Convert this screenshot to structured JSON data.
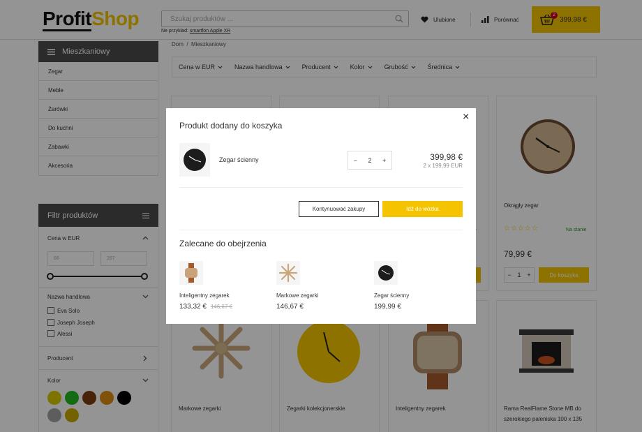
{
  "header": {
    "logo_part1": "Profit",
    "logo_part2": "Shop",
    "search_placeholder": "Szukaj produktów ...",
    "search_hint_prefix": "Ne przykład:",
    "search_hint_link": "smartfon Apple XR",
    "favorites_label": "Ulubione",
    "compare_label": "Porównać",
    "cart_count": "2",
    "cart_total": "399,98 €"
  },
  "sidebar": {
    "category_title": "Mieszkaniowy",
    "categories": [
      "Zegar",
      "Meble",
      "Żarówki",
      "Do kuchni",
      "Zabawki",
      "Akcesoria"
    ],
    "filter_title": "Filtr produktów",
    "price_label": "Cena w EUR",
    "price_min": "66",
    "price_max": "267",
    "brand_label": "Nazwa handlowa",
    "brands": [
      "Eva Solo",
      "Joseph Joseph",
      "Alessi"
    ],
    "producer_label": "Producent",
    "color_label": "Kolor",
    "colors": [
      "#d8c800",
      "#22bb22",
      "#7a3e10",
      "#dd8c10",
      "#000000",
      "#a0a0a0",
      "#c8a800"
    ]
  },
  "main": {
    "breadcrumb_home": "Dom",
    "breadcrumb_sep": "/",
    "breadcrumb_current": "Mieszkaniowy",
    "filter_dropdowns": [
      "Cena w EUR",
      "Nazwa handlowa",
      "Producent",
      "Kolor",
      "Grubość",
      "Średnica"
    ],
    "top_right_product": {
      "name": "Okrągły zegar",
      "stock": "Na stanie",
      "price": "79,99 €",
      "qty": "1",
      "add_label": "Do koszyka"
    },
    "bottom_products": [
      "Markowe zegarki",
      "Zegarki kolekcjonerskie",
      "Inteligentny zegarek",
      "Rama RealFlame Stone MB do szerokiego paleniska 100 x 135"
    ]
  },
  "modal": {
    "title": "Produkt dodany do koszyka",
    "close_symbol": "×",
    "item_name": "Zegar ścienny",
    "qty": "2",
    "minus": "−",
    "plus": "+",
    "total": "399,98 €",
    "unit_line": "2 x 199,99 EUR",
    "continue_label": "Kontynuować zakupy",
    "cart_label": "Idź do wózka",
    "rec_title": "Zalecane do obejrzenia",
    "recommendations": [
      {
        "name": "Inteligentny zegarek",
        "price": "133,32 €",
        "old_price": "146,67 €"
      },
      {
        "name": "Markowe zegarki",
        "price": "146,67 €",
        "old_price": ""
      },
      {
        "name": "Zegar ścienny",
        "price": "199,99 €",
        "old_price": ""
      }
    ]
  }
}
